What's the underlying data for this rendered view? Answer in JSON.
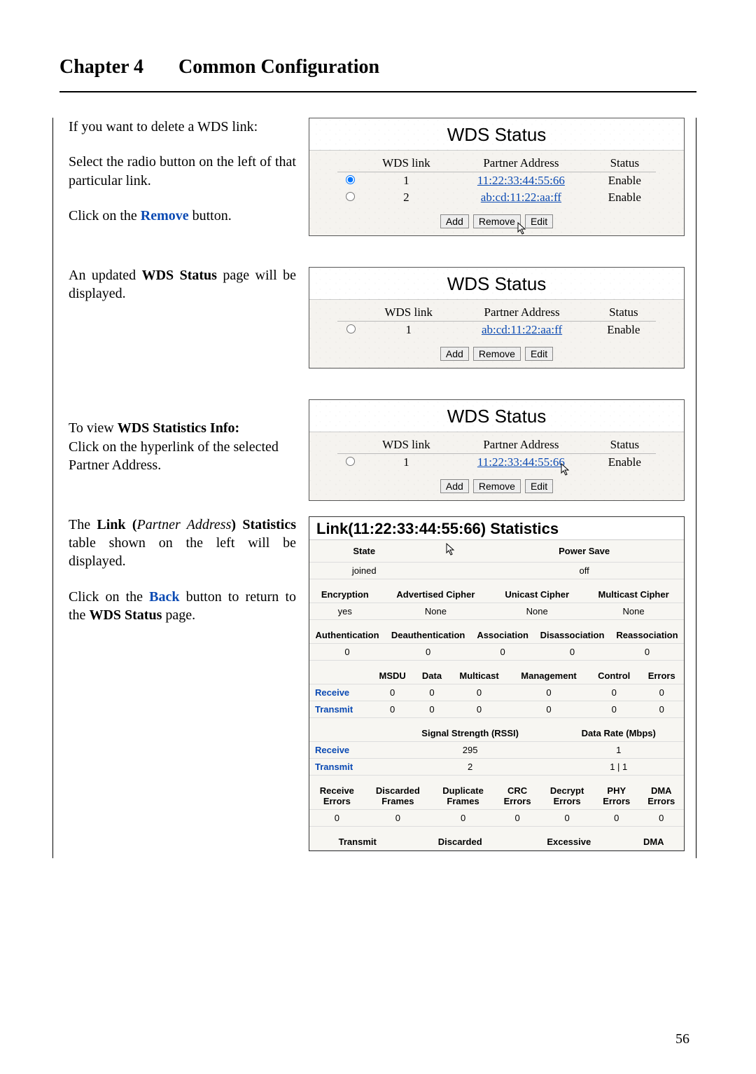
{
  "chapter": {
    "prefix": "Chapter 4",
    "title": "Common Configuration"
  },
  "left": {
    "p1a": "If you want to delete a WDS link:",
    "p1b": "Select the radio button on the left of that particular link.",
    "p1c_pre": "Click on the ",
    "p1c_btn": "Remove",
    "p1c_post": " button.",
    "p2_pre": "An updated ",
    "p2_bold": "WDS Status",
    "p2_post": " page will be displayed.",
    "p3_pre": "To view ",
    "p3_bold": "WDS Statistics Info:",
    "p3_post": "",
    "p3b": "Click on the hyperlink of the selected Partner Address.",
    "p4_pre": "The ",
    "p4_bold1": "Link (",
    "p4_ital": "Partner Address",
    "p4_bold2": ") Statistics",
    "p4_post": " table shown on the left will be displayed.",
    "p5_pre": "Click on the ",
    "p5_btn": "Back",
    "p5_mid": " button to return to the ",
    "p5_bold": "WDS Status",
    "p5_post": " page."
  },
  "panels": {
    "title": "WDS Status",
    "headers": {
      "link": "WDS link",
      "addr": "Partner Address",
      "status": "Status"
    },
    "btns": {
      "add": "Add",
      "remove": "Remove",
      "edit": "Edit"
    },
    "rows1": [
      {
        "sel": true,
        "n": "1",
        "addr": "11:22:33:44:55:66",
        "status": "Enable"
      },
      {
        "sel": false,
        "n": "2",
        "addr": "ab:cd:11:22:aa:ff",
        "status": "Enable"
      }
    ],
    "rows2": [
      {
        "sel": false,
        "n": "1",
        "addr": "ab:cd:11:22:aa:ff",
        "status": "Enable"
      }
    ],
    "rows3": [
      {
        "sel": false,
        "n": "1",
        "addr": "11:22:33:44:55:66",
        "status": "Enable"
      }
    ]
  },
  "stats": {
    "title": "Link(11:22:33:44:55:66) Statistics",
    "row1h": [
      "State",
      "",
      "Power Save"
    ],
    "row1v": [
      "joined",
      "",
      "off"
    ],
    "row2h": [
      "Encryption",
      "Advertised Cipher",
      "Unicast Cipher",
      "Multicast Cipher"
    ],
    "row2v": [
      "yes",
      "None",
      "None",
      "None"
    ],
    "row3h": [
      "Authentication",
      "Deauthentication",
      "Association",
      "Disassociation",
      "Reassociation"
    ],
    "row3v": [
      "0",
      "0",
      "0",
      "0",
      "0"
    ],
    "row4h": [
      "",
      "MSDU",
      "Data",
      "Multicast",
      "Management",
      "Control",
      "Errors"
    ],
    "row4_recv": "Receive",
    "row4r": [
      "0",
      "0",
      "0",
      "0",
      "0",
      "0"
    ],
    "row4_tx": "Transmit",
    "row4t": [
      "0",
      "0",
      "0",
      "0",
      "0",
      "0"
    ],
    "row5h": [
      "",
      "Signal Strength (RSSI)",
      "Data Rate (Mbps)"
    ],
    "row5_recv": "Receive",
    "row5r_a": "295",
    "row5r_b": "1",
    "row5_tx": "Transmit",
    "row5t_a": "2",
    "row5t_b": "1 | 1",
    "row6h": [
      "Receive Errors",
      "Discarded Frames",
      "Duplicate Frames",
      "CRC Errors",
      "Decrypt Errors",
      "PHY Errors",
      "DMA Errors"
    ],
    "row6v": [
      "0",
      "0",
      "0",
      "0",
      "0",
      "0",
      "0"
    ],
    "row7h": [
      "Transmit",
      "Discarded",
      "Excessive",
      "DMA"
    ]
  },
  "page_number": "56"
}
